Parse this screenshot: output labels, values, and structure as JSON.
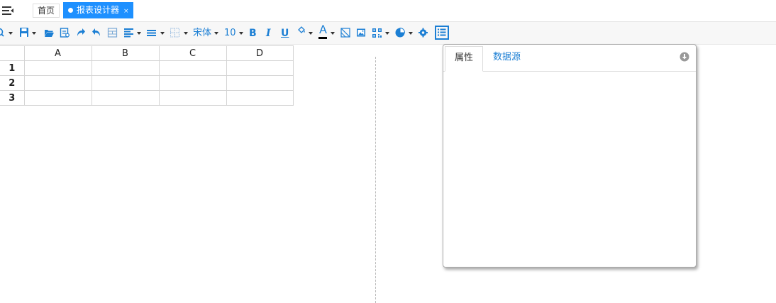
{
  "tabs": {
    "home_label": "首页",
    "active_label": "报表设计器",
    "close_glyph": "×"
  },
  "toolbar": {
    "font_name": "宋体",
    "font_size": "10",
    "bold": "B",
    "italic": "I",
    "underline": "U",
    "font_color": "A",
    "icons": [
      "search-icon",
      "save-icon",
      "open-folder-icon",
      "preview-icon",
      "redo-icon",
      "undo-icon",
      "merge-cells-icon",
      "align-icon",
      "line-icon",
      "border-icon",
      "fill-color-icon",
      "font-color-icon",
      "slash-cell-icon",
      "image-icon",
      "qrcode-icon",
      "chart-icon",
      "settings-icon",
      "list-icon"
    ]
  },
  "grid": {
    "columns": [
      "A",
      "B",
      "C",
      "D"
    ],
    "rows": [
      "1",
      "2",
      "3"
    ]
  },
  "panel": {
    "tab_properties": "属性",
    "tab_datasource": "数据源"
  },
  "colors": {
    "accent": "#1e90ff",
    "icon_blue": "#1c7fd4"
  }
}
